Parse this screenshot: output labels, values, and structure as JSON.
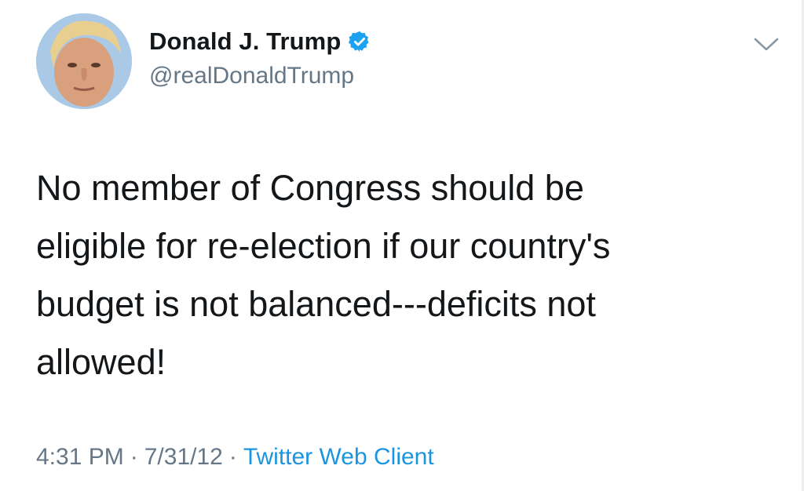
{
  "tweet": {
    "author": {
      "display_name": "Donald J. Trump",
      "handle": "@realDonaldTrump",
      "verified": true,
      "avatar_icon": "profile-photo"
    },
    "menu_icon": "chevron-down-icon",
    "text_lines": [
      "No member of Congress should be",
      "eligible for re-election if our country's",
      "budget is not balanced---deficits not",
      "allowed!"
    ],
    "meta": {
      "time": "4:31 PM",
      "separator": "·",
      "date": "7/31/12",
      "source": "Twitter Web Client"
    }
  },
  "colors": {
    "text_primary": "#14171a",
    "text_secondary": "#657786",
    "link": "#1b95e0",
    "verified_badge": "#1da1f2"
  }
}
